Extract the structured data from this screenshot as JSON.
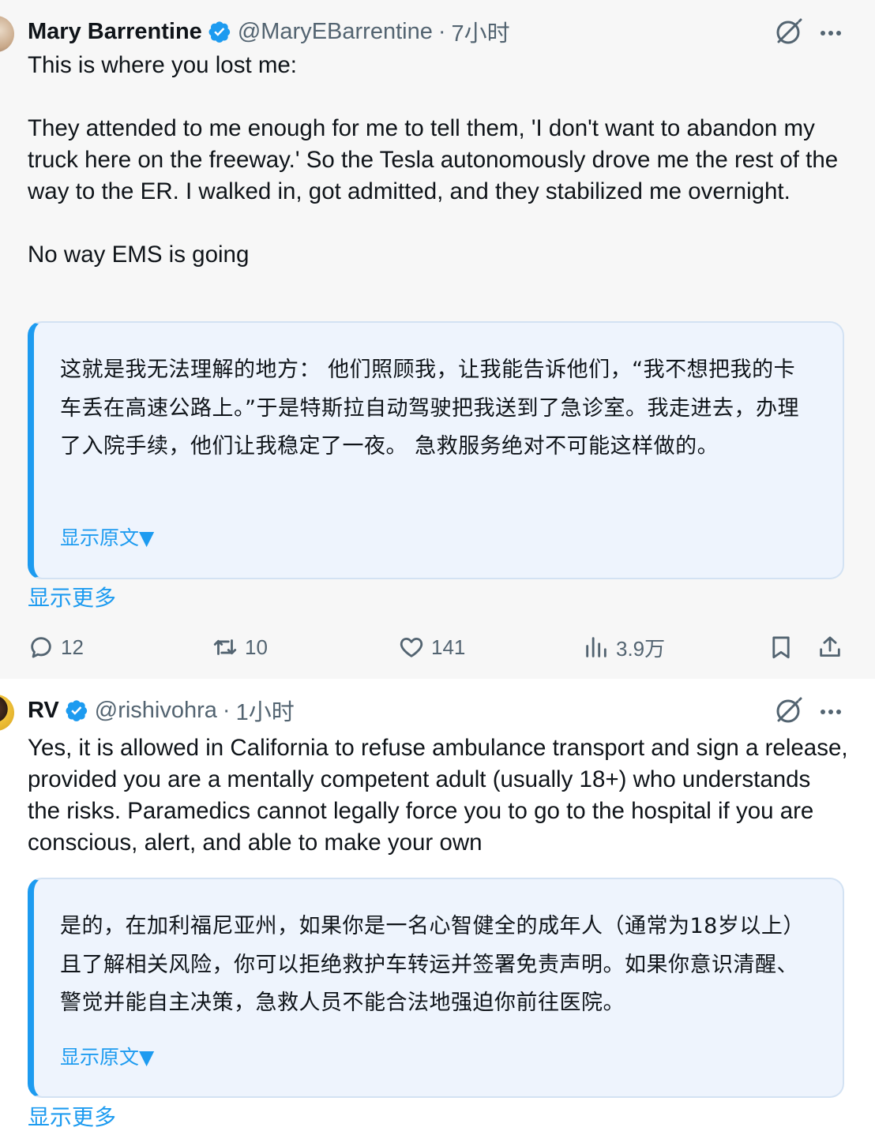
{
  "tweets": [
    {
      "author": {
        "name": "Mary Barrentine",
        "handle": "@MaryEBarrentine",
        "verified": true
      },
      "separator": "·",
      "time": "7小时",
      "text": "This is where you lost me:\n\nThey attended to me enough for me to tell them, 'I don't want to abandon my truck here on the freeway.' So the Tesla autonomously drove me the rest of the way to the ER. I walked in, got admitted, and they stabilized me overnight.\n\nNo way EMS is going",
      "translation": "这就是我无法理解的地方： 他们照顾我，让我能告诉他们，“我不想把我的卡车丢在高速公路上。”于是特斯拉自动驾驶把我送到了急诊室。我走进去，办理了入院手续，他们让我稳定了一夜。 急救服务绝对不可能这样做的。",
      "show_original": "显示原文▼",
      "show_more": "显示更多",
      "stats": {
        "replies": "12",
        "retweets": "10",
        "likes": "141",
        "views": "3.9万"
      }
    },
    {
      "author": {
        "name": "RV",
        "handle": "@rishivohra",
        "verified": true
      },
      "separator": "·",
      "time": "1小时",
      "text": "Yes, it is allowed in California to refuse ambulance transport and sign a release, provided you are a mentally competent adult (usually 18+) who understands the risks. Paramedics cannot legally force you to go to the hospital if you are conscious, alert, and able to make your own",
      "translation": "是的，在加利福尼亚州，如果你是一名心智健全的成年人（通常为18岁以上）且了解相关风险，你可以拒绝救护车转运并签署免责声明。如果你意识清醒、警觉并能自主决策，急救人员不能合法地强迫你前往医院。",
      "show_original": "显示原文▼",
      "show_more": "显示更多"
    }
  ],
  "colors": {
    "accent": "#1d9bf0",
    "muted_text": "#536471",
    "text": "#0f1419",
    "tweet1_background": "#f7f7f7",
    "translation_background": "#eef4fd"
  },
  "icons": [
    "verified-badge-icon",
    "grok-icon",
    "more-icon",
    "reply-icon",
    "retweet-icon",
    "like-icon",
    "views-icon",
    "bookmark-icon",
    "share-icon"
  ]
}
